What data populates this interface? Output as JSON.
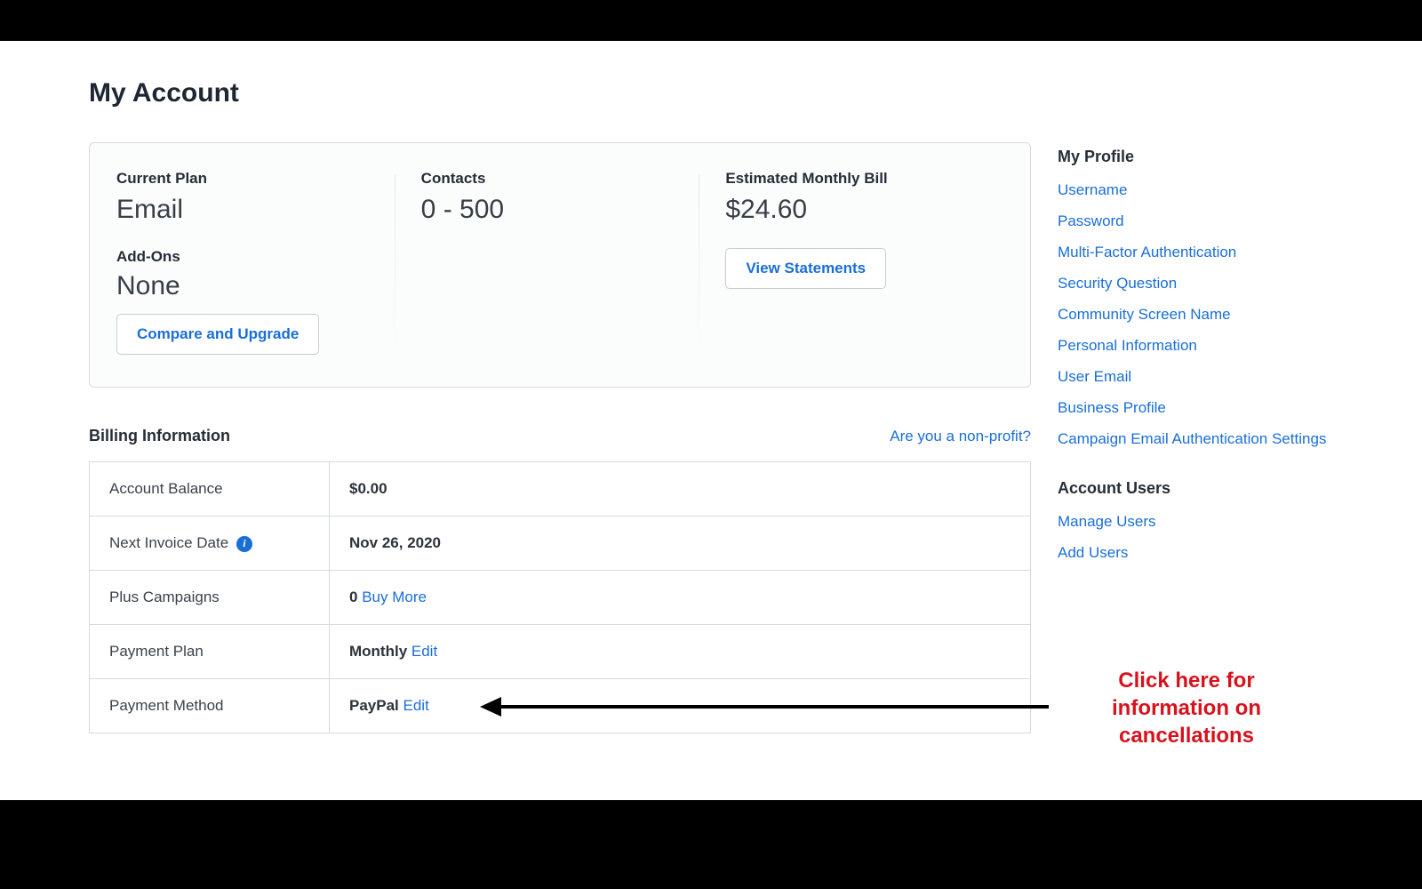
{
  "page": {
    "title": "My Account"
  },
  "plan_card": {
    "current_plan_label": "Current Plan",
    "current_plan_value": "Email",
    "addons_label": "Add-Ons",
    "addons_value": "None",
    "compare_btn": "Compare and Upgrade",
    "contacts_label": "Contacts",
    "contacts_value": "0 - 500",
    "bill_label": "Estimated Monthly Bill",
    "bill_value": "$24.60",
    "statements_btn": "View Statements"
  },
  "billing": {
    "heading": "Billing Information",
    "nonprofit_link": "Are you a non-profit?",
    "rows": {
      "balance_label": "Account Balance",
      "balance_value": "$0.00",
      "invoice_label": "Next Invoice Date",
      "invoice_value": "Nov 26, 2020",
      "plus_label": "Plus Campaigns",
      "plus_value": "0",
      "plus_link": "Buy More",
      "plan_label": "Payment Plan",
      "plan_value": "Monthly",
      "plan_link": "Edit",
      "method_label": "Payment Method",
      "method_value": "PayPal",
      "method_link": "Edit"
    }
  },
  "sidebar": {
    "profile_heading": "My Profile",
    "profile_links": [
      "Username",
      "Password",
      "Multi-Factor Authentication",
      "Security Question",
      "Community Screen Name",
      "Personal Information",
      "User Email",
      "Business Profile",
      "Campaign Email Authentication Settings"
    ],
    "users_heading": "Account Users",
    "users_links": [
      "Manage Users",
      "Add Users"
    ]
  },
  "annotation": {
    "text": "Click here for information on cancellations"
  },
  "icons": {
    "info": "i"
  }
}
